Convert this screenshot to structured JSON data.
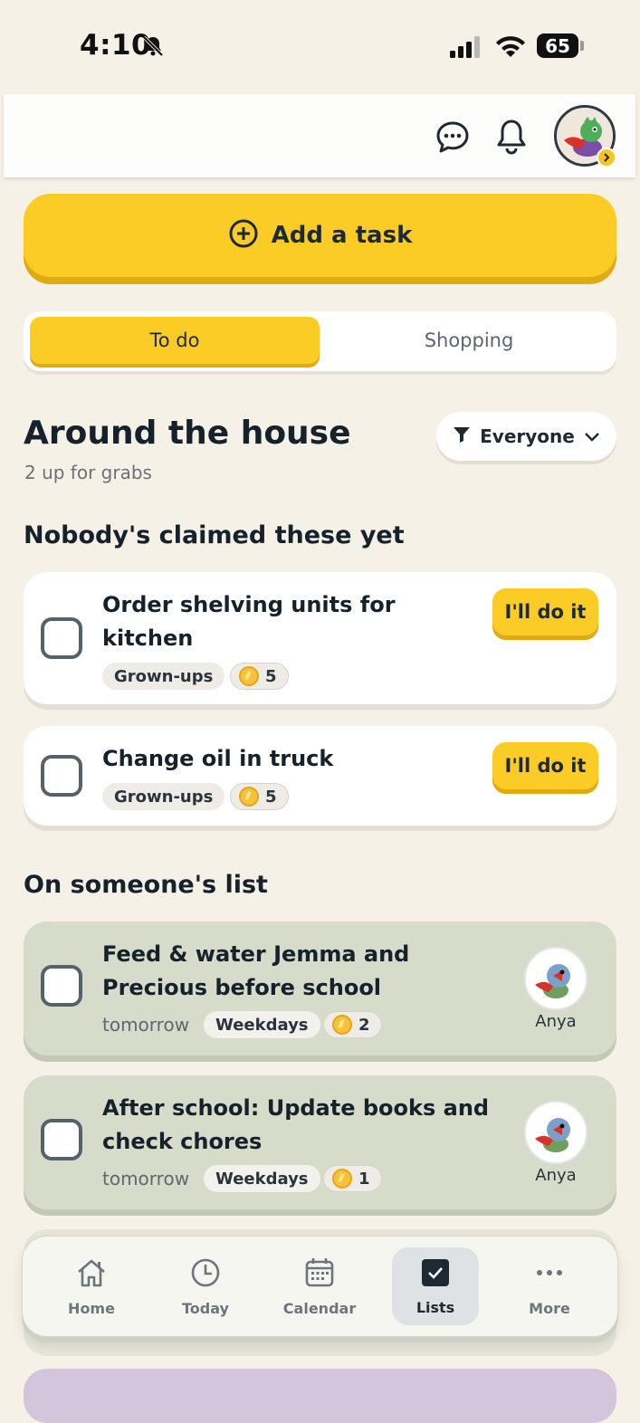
{
  "status_bar": {
    "time": "4:10",
    "battery": "65"
  },
  "add_task": {
    "label": "Add a task"
  },
  "segments": [
    {
      "label": "To do",
      "active": true
    },
    {
      "label": "Shopping",
      "active": false
    }
  ],
  "section": {
    "title": "Around the house",
    "subtitle": "2 up for grabs",
    "filter_label": "Everyone"
  },
  "unclaimed": {
    "heading": "Nobody's claimed these yet",
    "tasks": [
      {
        "title_line1": "Order shelving units for",
        "title_line2": "kitchen",
        "tag": "Grown-ups",
        "coins": "5",
        "action": "I'll do it"
      },
      {
        "title_line1": "Change oil in truck",
        "tag": "Grown-ups",
        "coins": "5",
        "action": "I'll do it"
      }
    ]
  },
  "claimed": {
    "heading": "On someone's list",
    "tasks": [
      {
        "title_line1": "Feed & water Jemma and",
        "title_line2": "Precious before school",
        "due": "tomorrow",
        "repeat": "Weekdays",
        "coins": "2",
        "assignee": "Anya"
      },
      {
        "title_line1": "After school: Update books and",
        "title_line2": "check chores",
        "due": "tomorrow",
        "repeat": "Weekdays",
        "coins": "1",
        "assignee": "Anya"
      }
    ]
  },
  "tab_bar": [
    {
      "label": "Home",
      "icon": "house-icon"
    },
    {
      "label": "Today",
      "icon": "clock-icon"
    },
    {
      "label": "Calendar",
      "icon": "calendar-icon"
    },
    {
      "label": "Lists",
      "icon": "checkbox-icon",
      "active": true
    },
    {
      "label": "More",
      "icon": "ellipsis-icon"
    }
  ],
  "colors": {
    "background": "#f6f1e7",
    "accent_yellow": "#fbcb26",
    "claimed_card": "#d7dcca",
    "text_dark": "#16222b"
  }
}
